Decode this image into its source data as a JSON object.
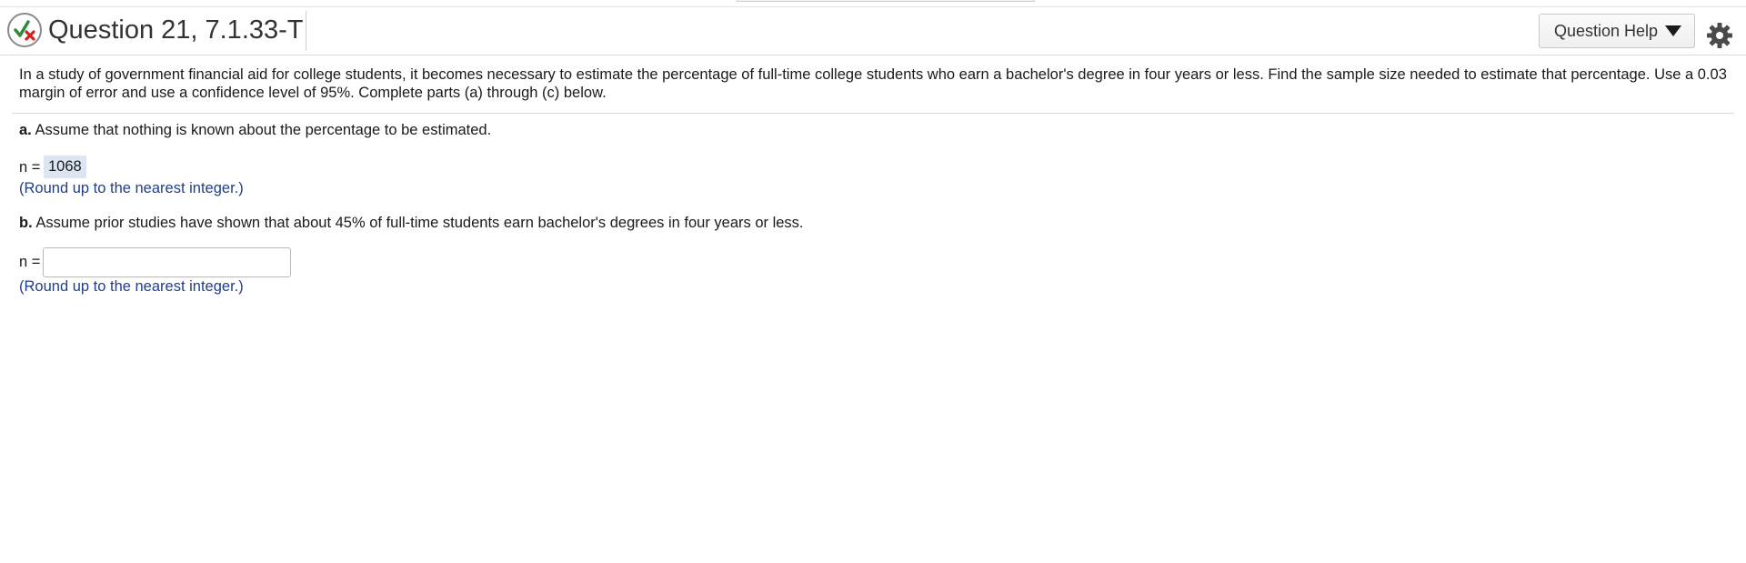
{
  "header": {
    "title": "Question 21, 7.1.33-T",
    "help_label": "Question Help",
    "status_icon": "partial-correct-icon",
    "settings_icon": "gear-icon"
  },
  "problem": {
    "intro": "In a study of government financial aid for college students, it becomes necessary to estimate the percentage of full-time college students who earn a bachelor's degree in four years or less. Find the sample size needed to estimate that percentage. Use a 0.03 margin of error and use a confidence level of 95%. Complete parts (a) through (c) below."
  },
  "part_a": {
    "letter": "a.",
    "text": " Assume that nothing is known about the percentage to be estimated.",
    "n_label": "n =",
    "answer": "1068",
    "hint": "(Round up to the nearest integer.)"
  },
  "part_b": {
    "letter": "b.",
    "text": " Assume prior studies have shown that about 45% of full-time students earn bachelor's degrees in four years or less.",
    "n_label": "n =",
    "answer": "",
    "hint": "(Round up to the nearest integer.)"
  },
  "colors": {
    "hint": "#1f3f8a",
    "answer_highlight": "#dce6f2",
    "check_green": "#2e8b3a",
    "cross_red": "#d42020"
  }
}
